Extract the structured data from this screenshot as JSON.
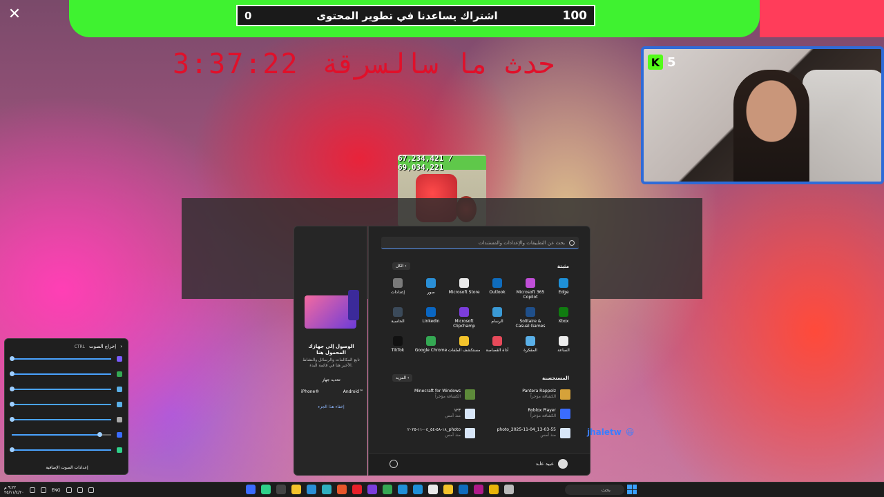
{
  "overlay": {
    "subgoal_left": "0",
    "subgoal_text": "اشتراك يساعدنا في تطوير المحتوى",
    "subgoal_right": "100",
    "red_title": "حدث ما سالسرقة",
    "timer": "3:37:22",
    "close_glyph": "✕"
  },
  "webcam": {
    "kick_letter": "K",
    "viewers": "5"
  },
  "game": {
    "hp": "67,234,421 / 69,034,221"
  },
  "chat": {
    "username": "jhaletw",
    "emoji": "😃"
  },
  "phone_link": {
    "title": "الوصول إلى جهازك المحمول هنا",
    "desc": "تابع المكالمات والرسائل والنشاط الأخير هنا في قائمة البدء.",
    "choose": "تحديد جهاز",
    "iphone": "iPhone®",
    "android": "Android™",
    "hide": "إخفاء هذا الجزء"
  },
  "start_menu": {
    "search_placeholder": "بحث عن التطبيقات والإعدادات والمستندات",
    "pinned_title": "مثبتة",
    "all_label": "الكل",
    "pinned": [
      {
        "label": "Edge",
        "icon": "edge-icon",
        "color": "#1e90d8"
      },
      {
        "label": "Microsoft 365 Copilot",
        "icon": "copilot-icon",
        "color": "#c14fd8"
      },
      {
        "label": "Outlook",
        "icon": "outlook-icon",
        "color": "#0f6cbd"
      },
      {
        "label": "Microsoft Store",
        "icon": "store-icon",
        "color": "#e9e9e9"
      },
      {
        "label": "صور",
        "icon": "photos-icon",
        "color": "#2a8fd6"
      },
      {
        "label": "إعدادات",
        "icon": "settings-icon",
        "color": "#7a7a7a"
      },
      {
        "label": "Xbox",
        "icon": "xbox-icon",
        "color": "#107c10"
      },
      {
        "label": "Solitaire & Casual Games",
        "icon": "solitaire-icon",
        "color": "#1f4f8a"
      },
      {
        "label": "الرسام",
        "icon": "paint-icon",
        "color": "#3a9ad6"
      },
      {
        "label": "Microsoft Clipchamp",
        "icon": "clipchamp-icon",
        "color": "#7b3ddc"
      },
      {
        "label": "LinkedIn",
        "icon": "linkedin-icon",
        "color": "#0a66c2"
      },
      {
        "label": "الحاسبة",
        "icon": "calculator-icon",
        "color": "#3b4a5a"
      },
      {
        "label": "الساعة",
        "icon": "clock-icon",
        "color": "#ececec"
      },
      {
        "label": "المفكرة",
        "icon": "notepad-icon",
        "color": "#5ab0e8"
      },
      {
        "label": "أداة القصاصة",
        "icon": "snipping-icon",
        "color": "#e74a5a"
      },
      {
        "label": "مستكشف الملفات",
        "icon": "folder-icon",
        "color": "#f3c32b"
      },
      {
        "label": "Google Chrome",
        "icon": "chrome-icon",
        "color": "#34a853"
      },
      {
        "label": "TikTok",
        "icon": "tiktok-icon",
        "color": "#111111"
      }
    ],
    "recommended_title": "المستحسنة",
    "more_label": "المزيد",
    "recommended": [
      {
        "title": "Pantera Rappelz",
        "sub": "الكشافة مؤخراً",
        "icon": "pantera-icon",
        "color": "#d6a23a"
      },
      {
        "title": "Minecraft for Windows",
        "sub": "الكشافة مؤخراً",
        "icon": "minecraft-icon",
        "color": "#5d8a3a"
      },
      {
        "title": "Roblox Player",
        "sub": "الكشافة مؤخراً",
        "icon": "roblox-icon",
        "color": "#3a6cff"
      },
      {
        "title": "١٢٣",
        "sub": "منذ أمس",
        "icon": "file-icon",
        "color": "#d8e6f8"
      },
      {
        "title": "photo_2025-11-04_13-03-55",
        "sub": "منذ أمس",
        "icon": "file-icon",
        "color": "#d8e6f8"
      },
      {
        "title": "photo_١٨-٥٨-٥٤_٠٤-١١-٢٠٢٥",
        "sub": "منذ أمس",
        "icon": "file-icon",
        "color": "#d8e6f8"
      }
    ],
    "user": "عبيد عابد"
  },
  "sound_panel": {
    "title": "إخراج الصوت",
    "ctrl": "CTRL",
    "sliders": [
      {
        "level": 1.0,
        "color": "#7a5cff"
      },
      {
        "level": 1.0,
        "color": "#34a853"
      },
      {
        "level": 1.0,
        "color": "#5ab0e8"
      },
      {
        "level": 1.0,
        "color": "#5ab0e8"
      },
      {
        "level": 1.0,
        "color": "#aaaaaa"
      },
      {
        "level": 0.88,
        "color": "#3a6cff"
      },
      {
        "level": 1.0,
        "color": "#2fd08a"
      }
    ],
    "more": "إعدادات الصوت الإضافية"
  },
  "taskbar": {
    "time": "٩:٢٢ م",
    "date": "٢٥/١١/٤/٢٠",
    "lang": "ENG",
    "search": "بحث",
    "icons": [
      {
        "icon": "app-icon-1",
        "color": "#3a6cff"
      },
      {
        "icon": "app-icon-2",
        "color": "#2fd08a"
      },
      {
        "icon": "obs-icon",
        "color": "#444444"
      },
      {
        "icon": "emoji-icon",
        "color": "#f3c32b"
      },
      {
        "icon": "app-icon-5",
        "color": "#2a8fd6"
      },
      {
        "icon": "app-icon-6",
        "color": "#2fb0c0"
      },
      {
        "icon": "app-icon-7",
        "color": "#e8562a"
      },
      {
        "icon": "opera-icon",
        "color": "#e8202a"
      },
      {
        "icon": "app-icon-9",
        "color": "#7b3ddc"
      },
      {
        "icon": "chrome-icon",
        "color": "#34a853"
      },
      {
        "icon": "app-icon-11",
        "color": "#1e90d8"
      },
      {
        "icon": "edge-icon",
        "color": "#1e90d8"
      },
      {
        "icon": "store-icon",
        "color": "#e9e9e9"
      },
      {
        "icon": "folder-icon",
        "color": "#f3c32b"
      },
      {
        "icon": "outlook-icon",
        "color": "#0f6cbd"
      },
      {
        "icon": "app-icon-16",
        "color": "#b01a8a"
      },
      {
        "icon": "app-icon-17",
        "color": "#e8b40a"
      },
      {
        "icon": "app-icon-18",
        "color": "#bbbbbb"
      }
    ]
  }
}
